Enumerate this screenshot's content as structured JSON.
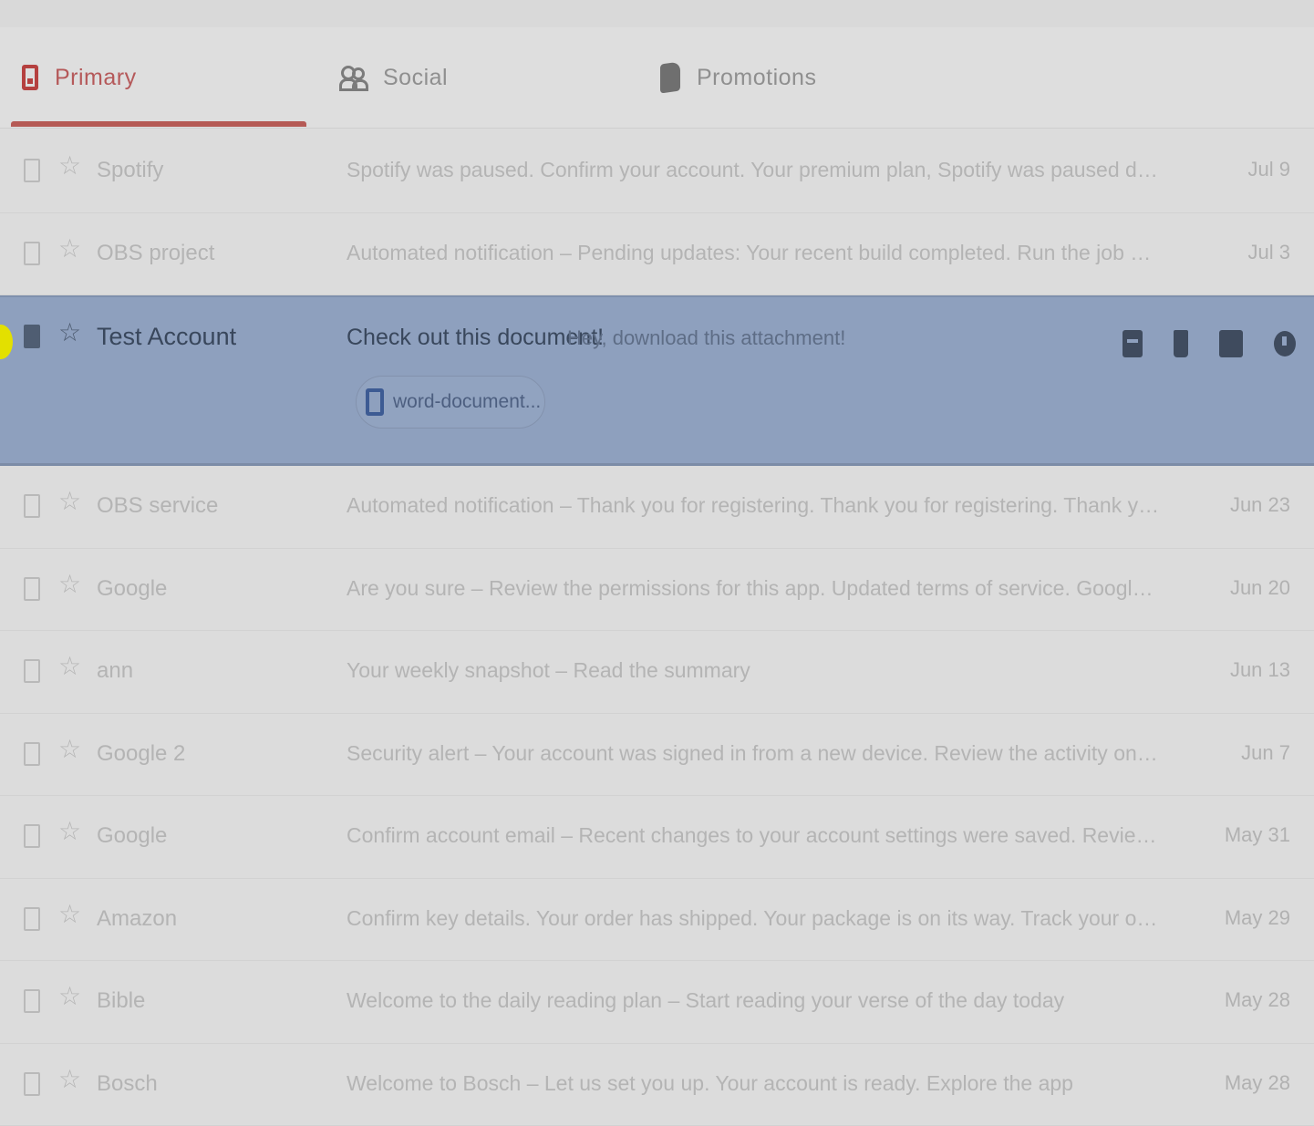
{
  "tabs": [
    {
      "label": "Primary",
      "icon": "inbox-icon",
      "active": true
    },
    {
      "label": "Social",
      "icon": "people-icon",
      "active": false
    },
    {
      "label": "Promotions",
      "icon": "tag-icon",
      "active": false
    }
  ],
  "emails": [
    {
      "sender": "Spotify",
      "snippet": "Spotify was paused. Confirm your account. Your premium plan, Spotify was paused due to a billing issue",
      "date": "Jul 9"
    },
    {
      "sender": "OBS project",
      "snippet": "Automated notification – Pending updates: Your recent build completed. Run the job again",
      "date": "Jul 3"
    },
    {
      "sender": "OBS service",
      "snippet": "Automated notification – Thank you for registering. Thank you for registering. Thank you for registering",
      "date": "Jun 23"
    },
    {
      "sender": "Google",
      "snippet": "Are you sure – Review the permissions for this app. Updated terms of service. Google Account notice",
      "date": "Jun 20"
    },
    {
      "sender": "ann",
      "snippet": "Your weekly snapshot – Read the summary",
      "date": "Jun 13"
    },
    {
      "sender": "Google 2",
      "snippet": "Security alert – Your account was signed in from a new device. Review the activity on your account",
      "date": "Jun 7"
    },
    {
      "sender": "Google",
      "snippet": "Confirm account email – Recent changes to your account settings were saved. Review your settings",
      "date": "May 31"
    },
    {
      "sender": "Amazon",
      "snippet": "Confirm key details. Your order has shipped. Your package is on its way. Track your order",
      "date": "May 29"
    },
    {
      "sender": "Bible",
      "snippet": "Welcome to the daily reading plan – Start reading your verse of the day today",
      "date": "May 28"
    },
    {
      "sender": "Bosch",
      "snippet": "Welcome to Bosch – Let us set you up. Your account is ready. Explore the app",
      "date": "May 28"
    }
  ],
  "selected_email": {
    "sender": "Test Account",
    "subject": "Check out this document!",
    "preview": "Hey, download this attachment!",
    "attachment": "word-document..."
  },
  "row_actions": [
    "archive-icon",
    "delete-icon",
    "mark-unread-icon",
    "snooze-icon"
  ],
  "colors": {
    "primary_tab": "#b5403f",
    "selected_row": "#8ea0be",
    "attachment_icon": "#3d5b93",
    "cursor_highlight": "#e3e000"
  }
}
